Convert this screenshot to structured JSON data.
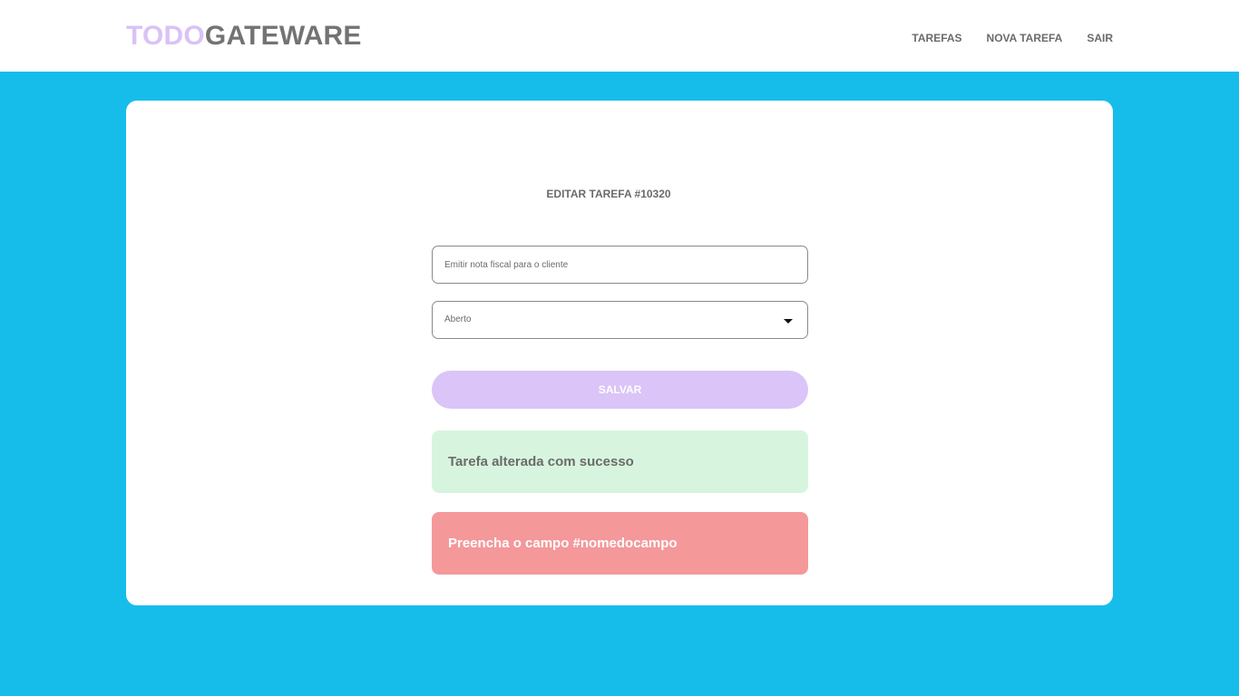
{
  "header": {
    "logo_part1": "TODO",
    "logo_part2": "GATEWARE",
    "nav": [
      {
        "label": "TAREFAS"
      },
      {
        "label": "NOVA TAREFA"
      },
      {
        "label": "SAIR"
      }
    ]
  },
  "form": {
    "title": "EDITAR TAREFA #10320",
    "description_value": "Emitir nota fiscal para o cliente",
    "status_value": "Aberto",
    "status_icon": "caret-down-icon",
    "save_label": "SALVAR"
  },
  "alerts": {
    "success": "Tarefa alterada com sucesso",
    "error": "Preencha o campo #nomedocampo"
  },
  "colors": {
    "background": "#16bdeb",
    "logo_accent": "#d9c2f5",
    "logo_text": "#737373",
    "button": "#dbc4f7",
    "success_bg": "#d7f5de",
    "error_bg": "#f4989a"
  }
}
